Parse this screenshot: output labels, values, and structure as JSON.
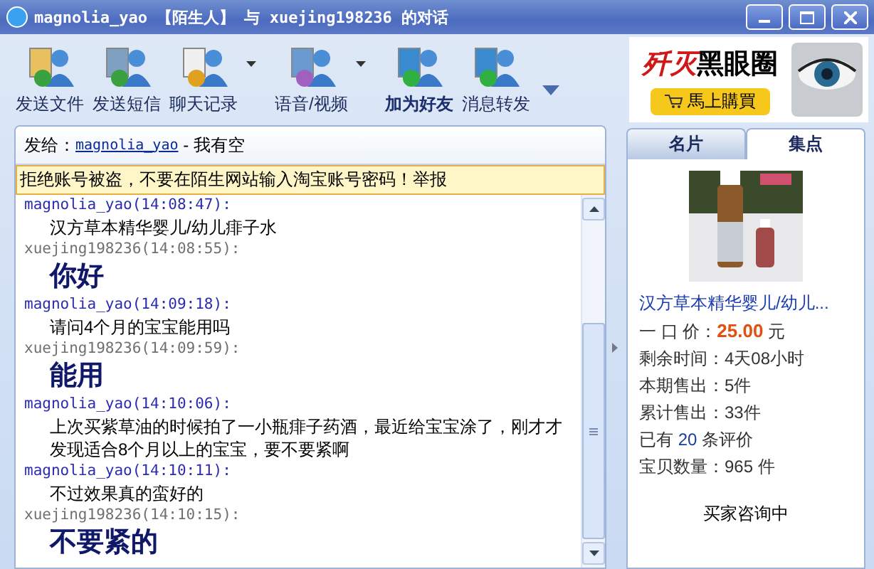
{
  "window": {
    "title": "magnolia_yao 【陌生人】 与 xuejing198236 的对话"
  },
  "toolbar": [
    {
      "label": "发送文件",
      "dropdown": false,
      "emphasized": false
    },
    {
      "label": "发送短信",
      "dropdown": false,
      "emphasized": false
    },
    {
      "label": "聊天记录",
      "dropdown": true,
      "emphasized": false
    },
    {
      "label": "语音/视频",
      "dropdown": true,
      "emphasized": false
    },
    {
      "label": "加为好友",
      "dropdown": false,
      "emphasized": true
    },
    {
      "label": "消息转发",
      "dropdown": false,
      "emphasized": false
    }
  ],
  "ad": {
    "headline_red": "歼灭",
    "headline_black": "黑眼圈",
    "button": "馬上購買"
  },
  "chat": {
    "to_label": "发给：",
    "to_name": "magnolia_yao",
    "to_status": " - 我有空",
    "warning": "拒绝账号被盗，不要在陌生网站输入淘宝账号密码！举报",
    "messages": [
      {
        "kind": "them",
        "header": "magnolia_yao(14:08:47):",
        "text": "汉方草本精华婴儿/幼儿痱子水",
        "large": false
      },
      {
        "kind": "me",
        "header": "xuejing198236(14:08:55):",
        "text": "你好",
        "large": true
      },
      {
        "kind": "them",
        "header": "magnolia_yao(14:09:18):",
        "text": "请问4个月的宝宝能用吗",
        "large": false
      },
      {
        "kind": "me",
        "header": "xuejing198236(14:09:59):",
        "text": "能用",
        "large": true
      },
      {
        "kind": "them",
        "header": "magnolia_yao(14:10:06):",
        "text": "上次买紫草油的时候拍了一小瓶痱子药酒，最近给宝宝涂了，刚才才发现适合8个月以上的宝宝，要不要紧啊",
        "large": false
      },
      {
        "kind": "them",
        "header": "magnolia_yao(14:10:11):",
        "text": "不过效果真的蛮好的",
        "large": false
      },
      {
        "kind": "me",
        "header": "xuejing198236(14:10:15):",
        "text": "不要紧的",
        "large": true
      }
    ]
  },
  "side": {
    "tabs": [
      {
        "label": "名片",
        "selected": false
      },
      {
        "label": "集点",
        "selected": true
      }
    ],
    "product": {
      "kind": "picture",
      "title": "汉方草本精华婴儿/幼儿...",
      "rows": [
        {
          "prefix": "一 口 价：",
          "highlight": "25.00",
          "suffix": " 元",
          "kind": "price"
        },
        {
          "prefix": "剩余时间：4天08小时",
          "kind": "plain"
        },
        {
          "prefix": "本期售出：5件",
          "kind": "plain"
        },
        {
          "prefix": "累计售出：33件",
          "kind": "plain"
        },
        {
          "prefix": "已有 ",
          "highlight": "20",
          "suffix": " 条评价",
          "kind": "count"
        },
        {
          "prefix": "宝贝数量：965 件",
          "kind": "plain"
        }
      ],
      "status": "买家咨询中"
    }
  }
}
